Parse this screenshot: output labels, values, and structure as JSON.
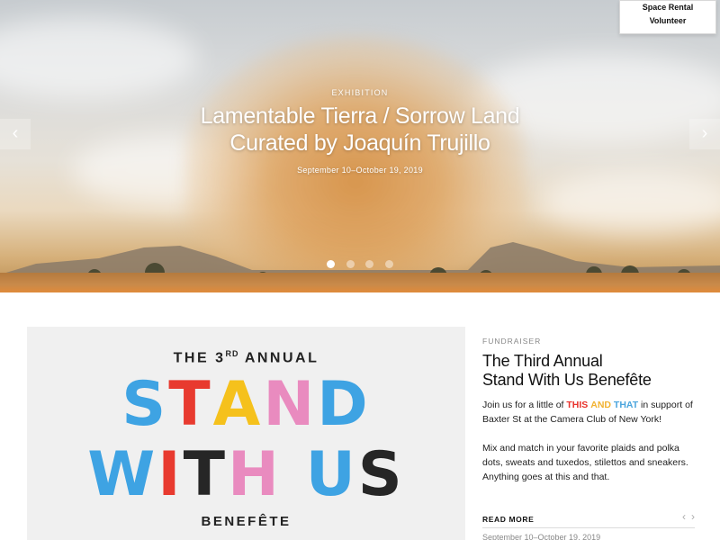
{
  "menu": {
    "items": [
      "Space Rental",
      "Volunteer"
    ]
  },
  "hero": {
    "kicker": "EXHIBITION",
    "title_line1": "Lamentable Tierra / Sorrow Land",
    "title_line2": "Curated by Joaquín Trujillo",
    "dates": "September 10–October 19, 2019",
    "prev_icon": "‹",
    "next_icon": "›",
    "slide_count": 4,
    "active_slide": 1
  },
  "poster": {
    "top_prefix": "THE 3",
    "top_sup": "RD",
    "top_suffix": " ANNUAL",
    "word1": "STAND",
    "word2": "WITH US",
    "bottom": "BENEFÊTE",
    "colors": {
      "blue": "#3ea3e3",
      "red": "#e83a2f",
      "yellow": "#f5c11c",
      "black": "#262626",
      "pink": "#e98bbf"
    }
  },
  "feature": {
    "kicker": "FUNDRAISER",
    "title_line1": "The Third Annual",
    "title_line2": "Stand With Us Benefête",
    "body1_before": "Join us for a little of ",
    "body1_this": "THIS",
    "body1_and": "AND",
    "body1_that": "THAT",
    "body1_after": " in support of Baxter St at the Camera Club of New York!",
    "body2": "Mix and match in your favorite plaids and polka dots, sweats and tuxedos, stilettos and sneakers. Anything goes at this and that.",
    "read_more": "READ MORE",
    "prev_icon": "‹",
    "next_icon": "›",
    "next_date": "September 10–October 19, 2019"
  }
}
